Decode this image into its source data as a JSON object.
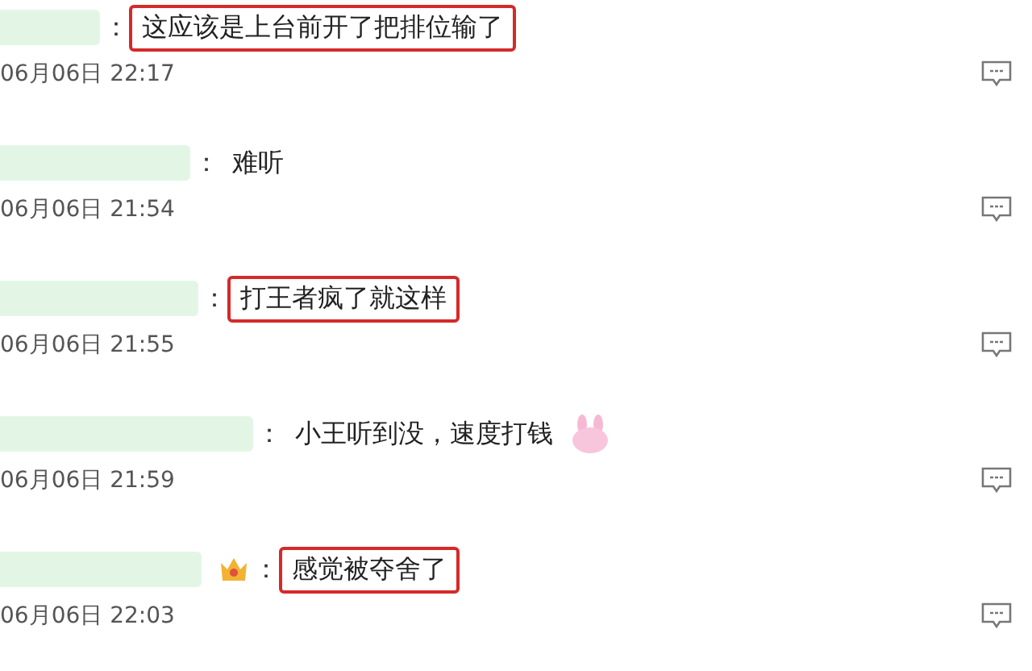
{
  "comments": [
    {
      "text": "这应该是上台前开了把排位输了",
      "time": "06月06日 22:17",
      "highlighted": true,
      "crown": false,
      "sticker": false
    },
    {
      "text": "难听",
      "time": "06月06日 21:54",
      "highlighted": false,
      "crown": false,
      "sticker": false
    },
    {
      "text": "打王者疯了就这样",
      "time": "06月06日 21:55",
      "highlighted": true,
      "crown": false,
      "sticker": false
    },
    {
      "text": "小王听到没，速度打钱",
      "time": "06月06日 21:59",
      "highlighted": false,
      "crown": false,
      "sticker": true
    },
    {
      "text": "感觉被夺舍了",
      "time": "06月06日 22:03",
      "highlighted": true,
      "crown": true,
      "sticker": false
    }
  ],
  "separator": "："
}
